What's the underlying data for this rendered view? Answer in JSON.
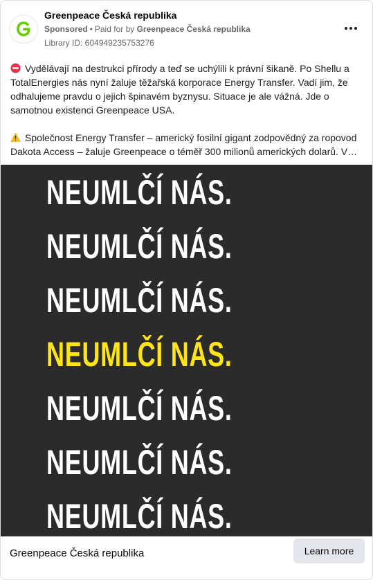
{
  "post": {
    "page_name": "Greenpeace Česká republika",
    "sponsored_label": "Sponsored",
    "separator": "•",
    "paid_for_prefix": "Paid for by",
    "paid_for_name": "Greenpeace Česká republika",
    "library_id": "Library ID: 604949235753276",
    "avatar_icon": "greenpeace-g-logo",
    "avatar_letter": "G",
    "more_icon": "more-options-icon",
    "body": {
      "paragraph_1": "Vydělávají na destrukci přírody a teď se uchýlili k právní šikaně. Po Shellu a TotalEnergies nás nyní žaluje těžařská korporace Energy Transfer. Vadí jim, že odhalujeme pravdu o jejich špinavém byznysu. Situace je ale vážná. Jde o samotnou existenci Greenpeace USA.",
      "paragraph_1_icon": "no-entry-emoji",
      "paragraph_2": "Společnost Energy Transfer – americký fosilní gigant zodpovědný za ropovod Dakota Access – žaluje Greenpeace o téměř 300 milionů amerických dolarů. V…",
      "paragraph_2_icon": "warning-emoji"
    },
    "creative": {
      "lines": [
        "NEUMLČÍ NÁS.",
        "NEUMLČÍ NÁS.",
        "NEUMLČÍ NÁS.",
        "NEUMLČÍ NÁS.",
        "NEUMLČÍ NÁS.",
        "NEUMLČÍ NÁS.",
        "NEUMLČÍ NÁS."
      ],
      "background_color": "#2b2b2b",
      "text_color": "#ffffff",
      "highlight_color": "#ffe41a",
      "highlight_index": 3
    },
    "footer": {
      "name": "Greenpeace Česká republika",
      "cta_label": "Learn more"
    }
  }
}
